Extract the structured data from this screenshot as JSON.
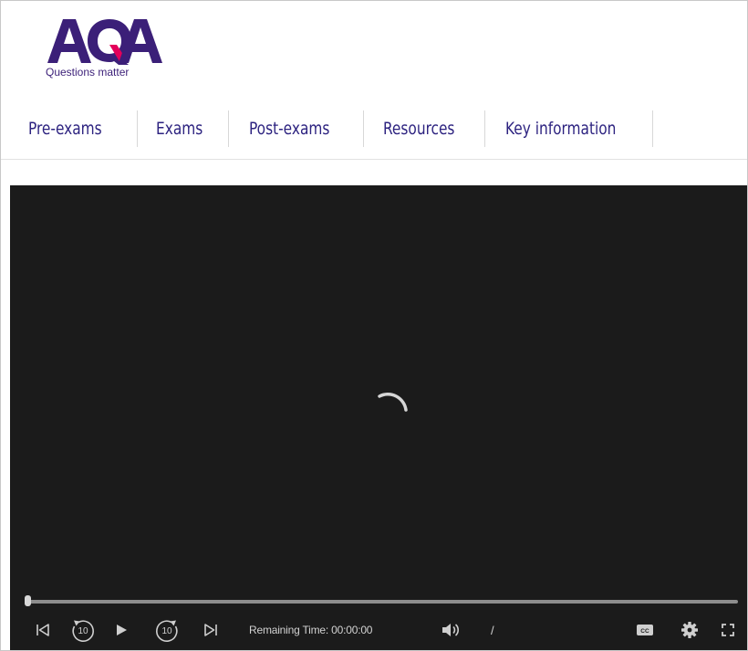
{
  "logo": {
    "wordmark": "AQA",
    "tagline": "Questions matter",
    "colors": {
      "letters": "#3b1f78",
      "accent": "#e4005a"
    }
  },
  "nav": {
    "items": [
      {
        "label": "Pre-exams"
      },
      {
        "label": "Exams"
      },
      {
        "label": "Post-exams"
      },
      {
        "label": "Resources"
      },
      {
        "label": "Key information"
      }
    ]
  },
  "player": {
    "state": "loading",
    "progress": 0,
    "remaining_time_label": "Remaining Time: 00:00:00",
    "time_separator": "/",
    "skip_seconds": "10",
    "controls": {
      "previous": "skip-to-start-icon",
      "rewind": "rewind-10-icon",
      "play": "play-icon",
      "forward": "forward-10-icon",
      "next": "skip-to-end-icon",
      "volume": "volume-icon",
      "captions": "closed-captions-icon",
      "settings": "gear-icon",
      "fullscreen": "fullscreen-icon"
    },
    "colors": {
      "background": "#1b1b1b",
      "controls": "#cfcfcf"
    }
  }
}
